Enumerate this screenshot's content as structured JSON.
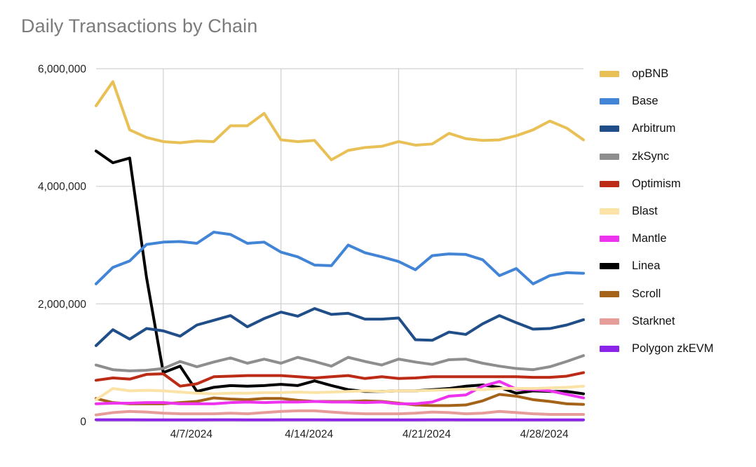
{
  "chart": {
    "title": "Daily Transactions by Chain"
  },
  "chart_data": {
    "type": "line",
    "title": "Daily Transactions by Chain",
    "xlabel": "",
    "ylabel": "",
    "grid": true,
    "legend_position": "right",
    "ylim": [
      0,
      6000000
    ],
    "yticks": [
      0,
      2000000,
      4000000,
      6000000
    ],
    "ytick_labels": [
      "0",
      "2,000,000",
      "4,000,000",
      "6,000,000"
    ],
    "xticks": [
      "4/7/2024",
      "4/14/2024",
      "4/21/2024",
      "4/28/2024"
    ],
    "x": [
      "4/3/2024",
      "4/4/2024",
      "4/5/2024",
      "4/6/2024",
      "4/7/2024",
      "4/8/2024",
      "4/9/2024",
      "4/10/2024",
      "4/11/2024",
      "4/12/2024",
      "4/13/2024",
      "4/14/2024",
      "4/15/2024",
      "4/16/2024",
      "4/17/2024",
      "4/18/2024",
      "4/19/2024",
      "4/20/2024",
      "4/21/2024",
      "4/22/2024",
      "4/23/2024",
      "4/24/2024",
      "4/25/2024",
      "4/26/2024",
      "4/27/2024",
      "4/28/2024",
      "4/29/2024",
      "4/30/2024",
      "5/1/2024",
      "5/2/2024"
    ],
    "series": [
      {
        "name": "opBNB",
        "color": "#e8c056",
        "values": [
          5370000,
          5780000,
          4960000,
          4830000,
          4760000,
          4740000,
          4770000,
          4760000,
          5030000,
          5030000,
          5240000,
          4790000,
          4760000,
          4780000,
          4450000,
          4610000,
          4660000,
          4680000,
          4760000,
          4700000,
          4720000,
          4900000,
          4810000,
          4780000,
          4790000,
          4860000,
          4960000,
          5110000,
          4990000,
          4790000
        ]
      },
      {
        "name": "Base",
        "color": "#4285d6",
        "values": [
          2340000,
          2620000,
          2730000,
          3010000,
          3050000,
          3060000,
          3030000,
          3220000,
          3180000,
          3030000,
          3050000,
          2880000,
          2800000,
          2660000,
          2650000,
          3000000,
          2870000,
          2800000,
          2720000,
          2580000,
          2820000,
          2850000,
          2840000,
          2750000,
          2480000,
          2600000,
          2340000,
          2480000,
          2530000,
          2520000
        ]
      },
      {
        "name": "Arbitrum",
        "color": "#1f4e88",
        "values": [
          1290000,
          1560000,
          1400000,
          1580000,
          1540000,
          1450000,
          1640000,
          1720000,
          1800000,
          1610000,
          1750000,
          1860000,
          1790000,
          1920000,
          1820000,
          1840000,
          1740000,
          1740000,
          1760000,
          1390000,
          1380000,
          1520000,
          1480000,
          1660000,
          1800000,
          1680000,
          1570000,
          1580000,
          1640000,
          1730000
        ]
      },
      {
        "name": "zkSync",
        "color": "#8e8e8e",
        "values": [
          960000,
          880000,
          860000,
          870000,
          900000,
          1020000,
          930000,
          1010000,
          1080000,
          990000,
          1060000,
          990000,
          1090000,
          1020000,
          940000,
          1090000,
          1020000,
          960000,
          1060000,
          1010000,
          970000,
          1050000,
          1060000,
          990000,
          940000,
          900000,
          880000,
          930000,
          1020000,
          1120000
        ]
      },
      {
        "name": "Optimism",
        "color": "#bb2b16",
        "values": [
          700000,
          740000,
          720000,
          800000,
          810000,
          600000,
          640000,
          760000,
          770000,
          780000,
          780000,
          780000,
          760000,
          740000,
          760000,
          780000,
          730000,
          760000,
          730000,
          740000,
          760000,
          760000,
          760000,
          760000,
          760000,
          760000,
          750000,
          750000,
          770000,
          830000
        ]
      },
      {
        "name": "Blast",
        "color": "#fbe3a8",
        "values": [
          370000,
          560000,
          520000,
          530000,
          520000,
          500000,
          480000,
          470000,
          480000,
          480000,
          490000,
          490000,
          500000,
          490000,
          500000,
          510000,
          520000,
          510000,
          520000,
          520000,
          530000,
          540000,
          550000,
          540000,
          560000,
          560000,
          560000,
          570000,
          580000,
          600000
        ]
      },
      {
        "name": "Mantle",
        "color": "#ee33ee",
        "values": [
          300000,
          310000,
          310000,
          320000,
          320000,
          300000,
          300000,
          300000,
          320000,
          330000,
          320000,
          330000,
          330000,
          340000,
          330000,
          330000,
          320000,
          330000,
          300000,
          300000,
          330000,
          430000,
          450000,
          600000,
          680000,
          550000,
          540000,
          520000,
          460000,
          400000
        ]
      },
      {
        "name": "Linea",
        "color": "#000000",
        "values": [
          4600000,
          4400000,
          4480000,
          2450000,
          830000,
          940000,
          510000,
          580000,
          610000,
          600000,
          610000,
          630000,
          610000,
          690000,
          610000,
          540000,
          510000,
          510000,
          520000,
          520000,
          540000,
          560000,
          600000,
          620000,
          580000,
          480000,
          520000,
          510000,
          510000,
          470000
        ]
      },
      {
        "name": "Scroll",
        "color": "#a5631a",
        "values": [
          390000,
          320000,
          300000,
          300000,
          300000,
          320000,
          340000,
          400000,
          380000,
          370000,
          390000,
          390000,
          360000,
          340000,
          340000,
          340000,
          350000,
          340000,
          310000,
          280000,
          270000,
          270000,
          280000,
          350000,
          460000,
          430000,
          370000,
          340000,
          300000,
          290000
        ]
      },
      {
        "name": "Starknet",
        "color": "#e69c98",
        "values": [
          110000,
          150000,
          170000,
          160000,
          140000,
          130000,
          130000,
          130000,
          140000,
          130000,
          150000,
          170000,
          180000,
          180000,
          160000,
          140000,
          130000,
          130000,
          130000,
          140000,
          160000,
          150000,
          130000,
          140000,
          170000,
          150000,
          130000,
          120000,
          120000,
          120000
        ]
      },
      {
        "name": "Polygon zkEVM",
        "color": "#8b23e8",
        "values": [
          28000,
          28000,
          28000,
          27000,
          27000,
          27000,
          27000,
          28000,
          28000,
          27000,
          27000,
          28000,
          28000,
          28000,
          27000,
          27000,
          27000,
          27000,
          27000,
          27000,
          28000,
          28000,
          27000,
          27000,
          27000,
          27000,
          27000,
          27000,
          27000,
          27000
        ]
      }
    ]
  },
  "legend": {
    "items": [
      {
        "label": "opBNB",
        "color": "#e8c056"
      },
      {
        "label": "Base",
        "color": "#4285d6"
      },
      {
        "label": "Arbitrum",
        "color": "#1f4e88"
      },
      {
        "label": "zkSync",
        "color": "#8e8e8e"
      },
      {
        "label": "Optimism",
        "color": "#bb2b16"
      },
      {
        "label": "Blast",
        "color": "#fbe3a8"
      },
      {
        "label": "Mantle",
        "color": "#ee33ee"
      },
      {
        "label": "Linea",
        "color": "#000000"
      },
      {
        "label": "Scroll",
        "color": "#a5631a"
      },
      {
        "label": "Starknet",
        "color": "#e69c98"
      },
      {
        "label": "Polygon zkEVM",
        "color": "#8b23e8"
      }
    ]
  }
}
